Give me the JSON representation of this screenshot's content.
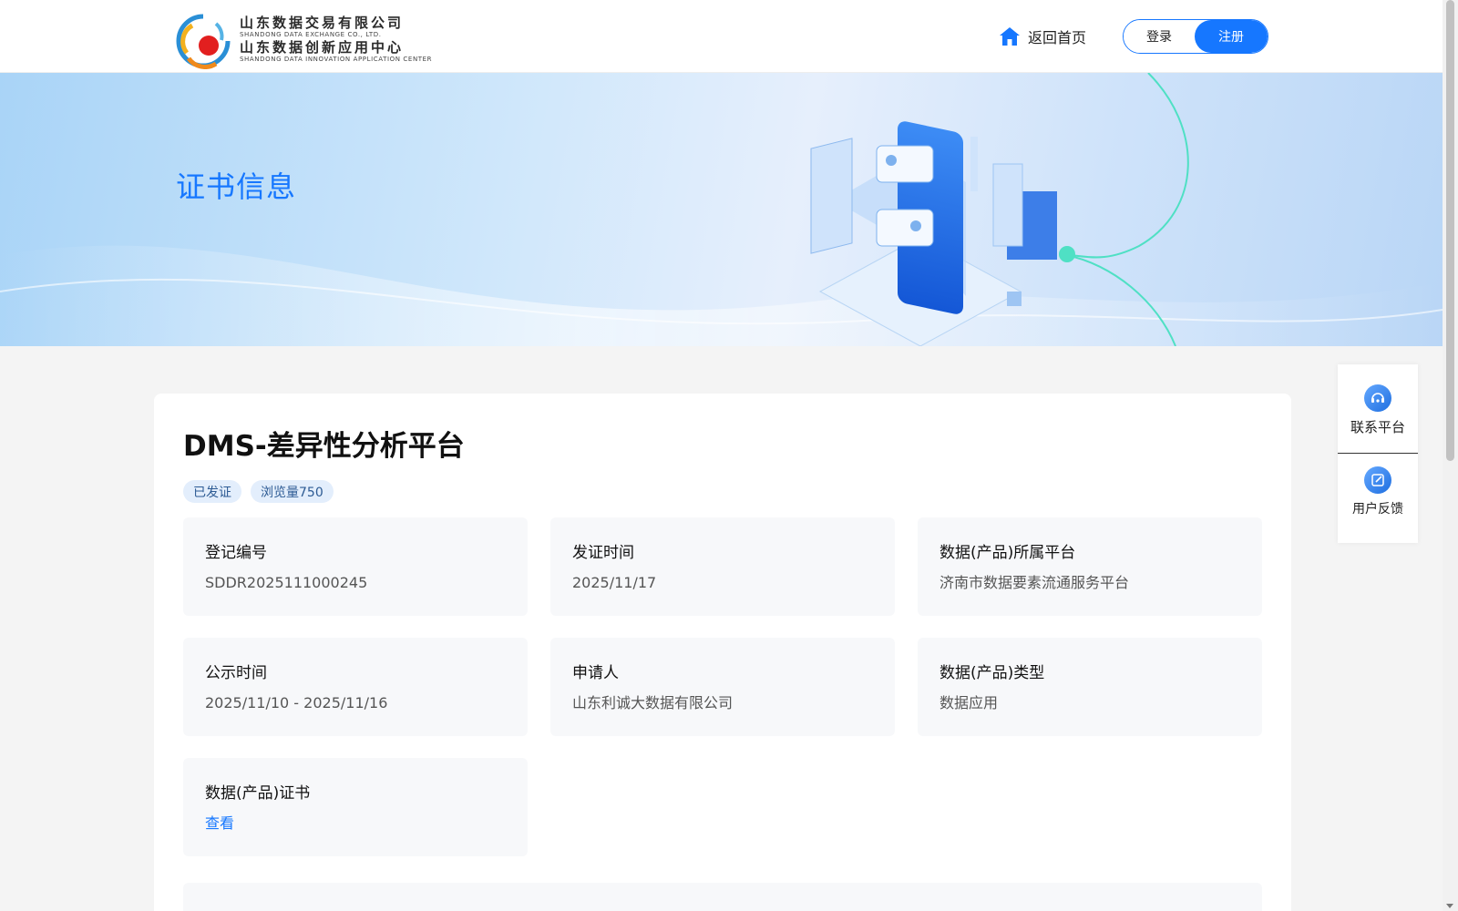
{
  "header": {
    "logo": {
      "line1_cn": "山东数据交易有限公司",
      "line1_en": "SHANDONG DATA EXCHANGE CO., LTD.",
      "line2_cn": "山东数据创新应用中心",
      "line2_en": "SHANDONG DATA INNOVATION APPLICATION CENTER"
    },
    "home_label": "返回首页",
    "login_label": "登录",
    "register_label": "注册",
    "accent": "#1677ff"
  },
  "banner": {
    "title": "证书信息"
  },
  "product": {
    "title": "DMS-差异性分析平台",
    "tags": [
      "已发证",
      "浏览量750"
    ],
    "fields": [
      {
        "label": "登记编号",
        "value": "SDDR2025111000245"
      },
      {
        "label": "发证时间",
        "value": "2025/11/17"
      },
      {
        "label": "数据(产品)所属平台",
        "value": "济南市数据要素流通服务平台"
      },
      {
        "label": "公示时间",
        "value": "2025/11/10 - 2025/11/16"
      },
      {
        "label": "申请人",
        "value": "山东利诚大数据有限公司"
      },
      {
        "label": "数据(产品)类型",
        "value": "数据应用"
      },
      {
        "label": "数据(产品)证书",
        "value": "查看"
      }
    ]
  },
  "side_float": {
    "contact_label": "联系平台",
    "feedback_label": "用户反馈"
  }
}
